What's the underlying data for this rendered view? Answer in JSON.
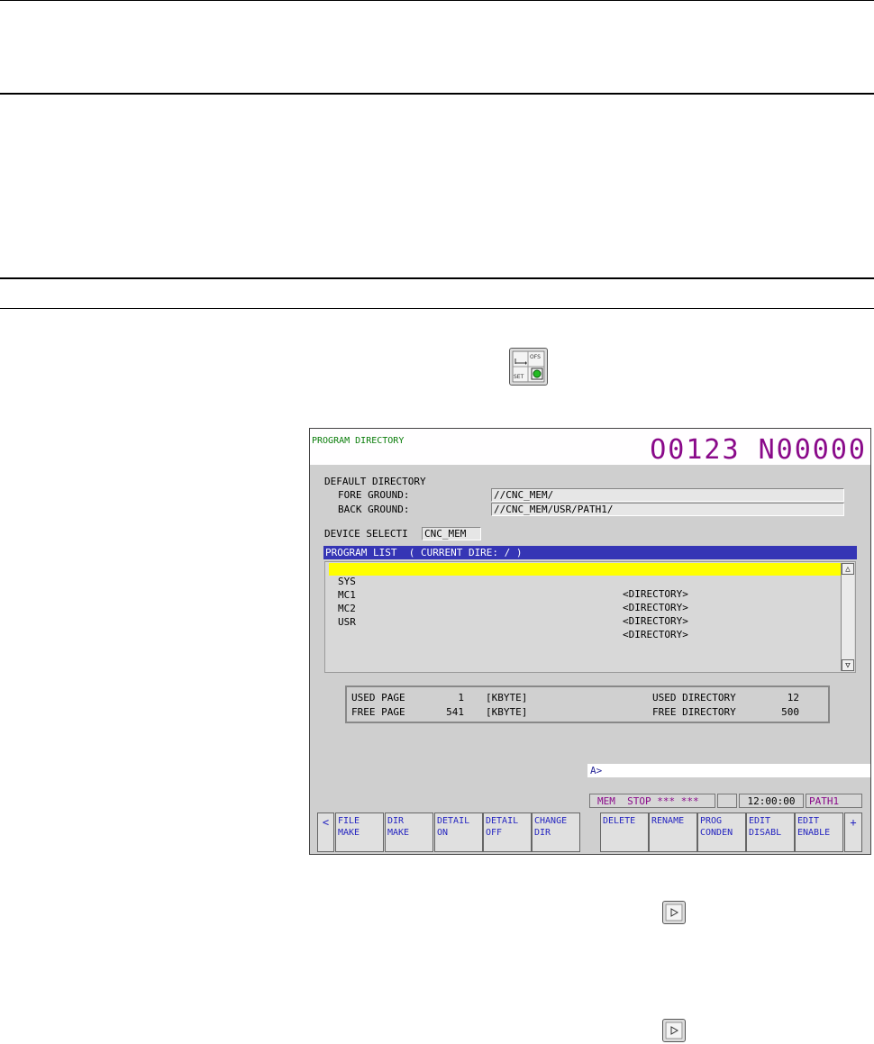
{
  "screen": {
    "title": "PROGRAM DIRECTORY",
    "program_number": "O0123 N00000",
    "default_directory_label": "DEFAULT DIRECTORY",
    "fore_ground_label": "FORE GROUND:",
    "fore_ground_value": "//CNC_MEM/",
    "back_ground_label": "BACK GROUND:",
    "back_ground_value": "//CNC_MEM/USR/PATH1/",
    "device_select_label": "DEVICE SELECTI",
    "device_select_value": "CNC_MEM",
    "program_list_header": "PROGRAM LIST  ( CURRENT DIRE: / )",
    "list": [
      {
        "name": "SYS",
        "type": "<DIRECTORY>"
      },
      {
        "name": "MC1",
        "type": "<DIRECTORY>"
      },
      {
        "name": "MC2",
        "type": "<DIRECTORY>"
      },
      {
        "name": "USR",
        "type": "<DIRECTORY>"
      }
    ],
    "scroll_up": "△",
    "scroll_down": "▽",
    "info": {
      "used_page_label": "USED PAGE",
      "used_page_value": "1",
      "used_page_unit": "[KBYTE]",
      "free_page_label": "FREE PAGE",
      "free_page_value": "541",
      "free_page_unit": "[KBYTE]",
      "used_dir_label": "USED DIRECTORY",
      "used_dir_value": "12",
      "free_dir_label": "FREE DIRECTORY",
      "free_dir_value": "500"
    },
    "command_prompt": "A>",
    "status": {
      "mode": "MEM  STOP *** ***",
      "time": "12:00:00",
      "path": "PATH1"
    },
    "softkeys": {
      "left_arrow": "<",
      "file_make": "FILE\nMAKE",
      "dir_make": "DIR\nMAKE",
      "detail_on": "DETAIL\nON",
      "detail_off": "DETAIL\nOFF",
      "change_dir": "CHANGE\nDIR",
      "delete": "DELETE",
      "rename": "RENAME",
      "prog_conden": "PROG\nCONDEN",
      "edit_disabl": "EDIT\nDISABL",
      "edit_enable": "EDIT\nENABLE",
      "plus": "+"
    }
  },
  "colors": {
    "title_green": "#0a7d0a",
    "program_number_magenta": "#8a0a8a",
    "list_header_blue": "#3535b5",
    "selection_yellow": "#ffff00",
    "softkey_text_blue": "#2525c0"
  },
  "icons": {
    "offset_setting_key": "offset-setting-key-icon",
    "next_menu_key": "next-menu-key-icon"
  }
}
